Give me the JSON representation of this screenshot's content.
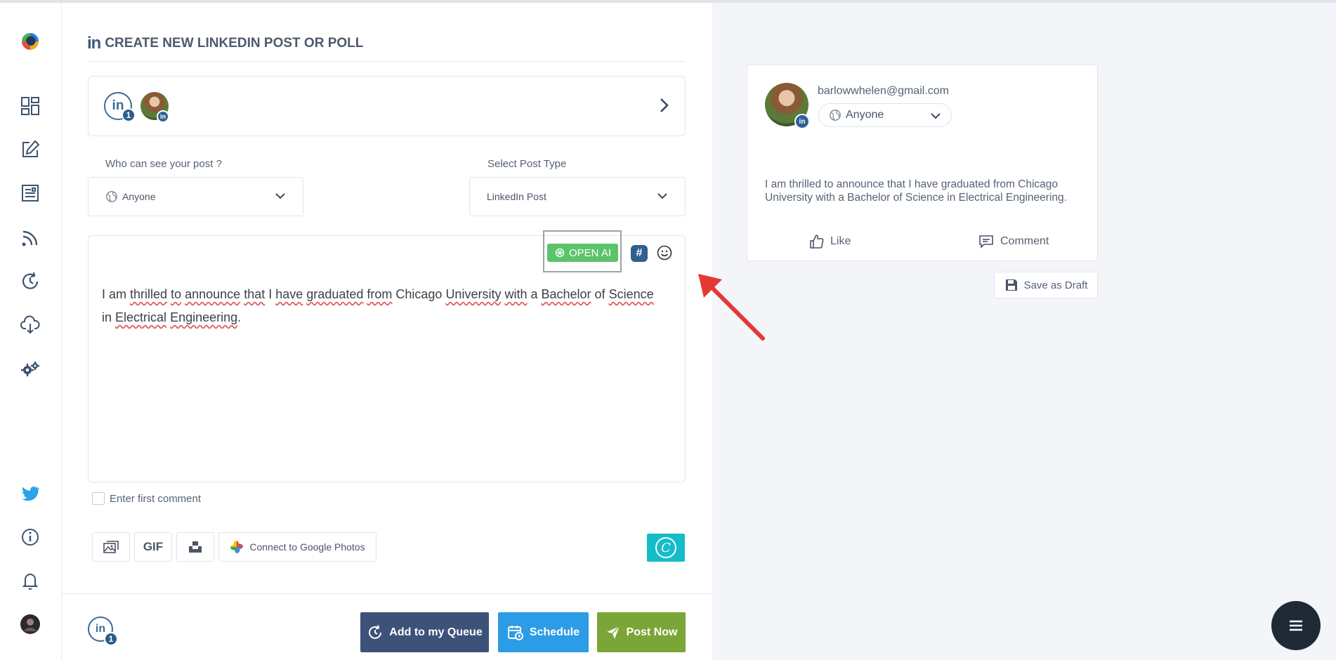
{
  "header": {
    "linkedin_mark": "in",
    "title": "CREATE NEW LINKEDIN POST OR POLL"
  },
  "accounts": {
    "linkedin_label": "in",
    "linkedin_count": "1",
    "avatar_badge": "in"
  },
  "visibility": {
    "label": "Who can see your post ?",
    "value": "Anyone"
  },
  "post_type": {
    "label": "Select Post Type",
    "value": "LinkedIn Post"
  },
  "editor": {
    "openai_label": "OPEN AI",
    "hashtag_label": "#",
    "text_segments": [
      {
        "t": "I am ",
        "u": false
      },
      {
        "t": "thrilled",
        "u": true
      },
      {
        "t": " ",
        "u": false
      },
      {
        "t": "to",
        "u": true
      },
      {
        "t": " ",
        "u": false
      },
      {
        "t": "announce",
        "u": true
      },
      {
        "t": " ",
        "u": false
      },
      {
        "t": "that",
        "u": true
      },
      {
        "t": " I ",
        "u": false
      },
      {
        "t": "have",
        "u": true
      },
      {
        "t": " ",
        "u": false
      },
      {
        "t": "graduated",
        "u": true
      },
      {
        "t": " ",
        "u": false
      },
      {
        "t": "from",
        "u": true
      },
      {
        "t": " Chicago ",
        "u": false
      },
      {
        "t": "University",
        "u": true
      },
      {
        "t": " ",
        "u": false
      },
      {
        "t": "with",
        "u": true
      },
      {
        "t": " a ",
        "u": false
      },
      {
        "t": "Bachelor",
        "u": true
      },
      {
        "t": " of ",
        "u": false
      },
      {
        "t": "Science",
        "u": true
      },
      {
        "t": " in ",
        "u": false
      },
      {
        "t": "Electrical",
        "u": true
      },
      {
        "t": " ",
        "u": false
      },
      {
        "t": "Engineering",
        "u": true
      },
      {
        "t": ".",
        "u": false
      }
    ]
  },
  "first_comment": {
    "label": "Enter first comment",
    "checked": false
  },
  "media": {
    "gif_label": "GIF",
    "google_photos_label": "Connect to Google Photos",
    "canva_label": "C"
  },
  "footer": {
    "linkedin_label": "in",
    "linkedin_count": "1",
    "queue_label": "Add to my Queue",
    "schedule_label": "Schedule",
    "post_now_label": "Post Now"
  },
  "preview": {
    "email": "barlowwhelen@gmail.com",
    "visibility": "Anyone",
    "avatar_badge": "in",
    "text": "I am thrilled to announce that I have graduated from Chicago University with a Bachelor of Science in Electrical Engineering.",
    "like_label": "Like",
    "comment_label": "Comment"
  },
  "draft": {
    "label": "Save as Draft"
  },
  "colors": {
    "linkedin_blue": "#3a6b97",
    "openai_green": "#5bc36a",
    "queue_navy": "#3d5278",
    "schedule_blue": "#2d9ce6",
    "post_green": "#7aa637",
    "canva_teal": "#14bdc8",
    "annotation_arrow": "#e53935"
  }
}
